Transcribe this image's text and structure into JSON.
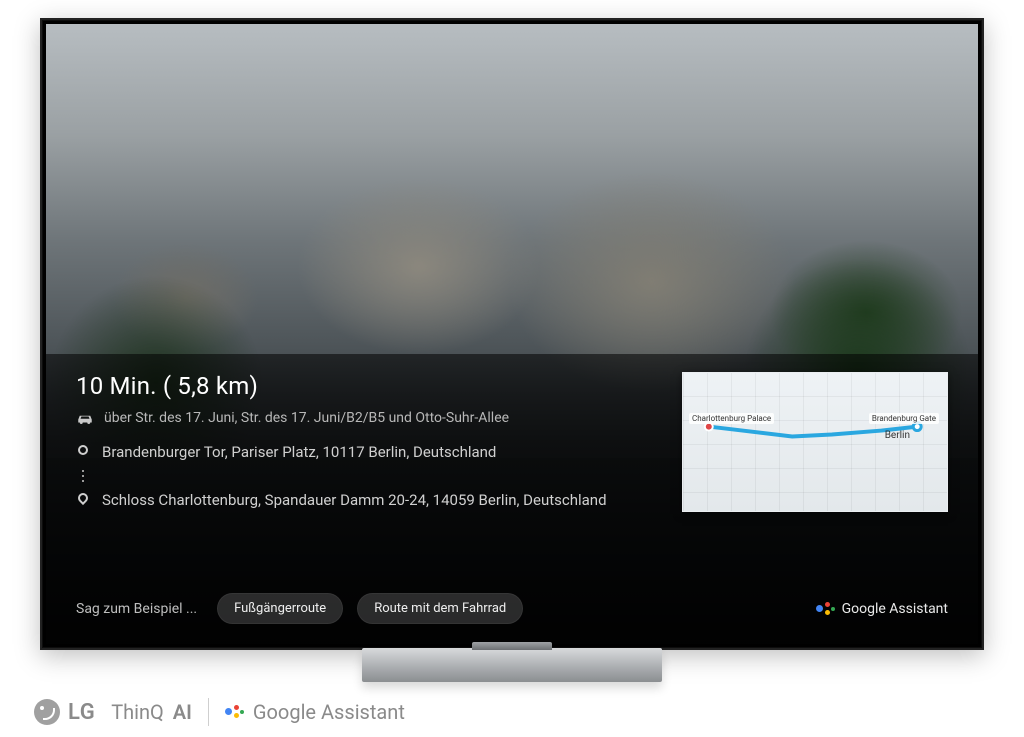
{
  "route": {
    "duration_distance": "10 Min. ( 5,8 km)",
    "via": "über Str. des 17. Juni, Str. des 17. Juni/B2/B5 und Otto-Suhr-Allee",
    "origin": "Brandenburger Tor, Pariser Platz, 10117 Berlin, Deutschland",
    "destination": "Schloss Charlottenburg, Spandauer Damm 20-24, 14059 Berlin, Deutschland"
  },
  "map": {
    "label_origin": "Brandenburg Gate",
    "label_destination": "Charlottenburg Palace",
    "city_label": "Berlin"
  },
  "suggestions": {
    "prompt": "Sag zum Beispiel ...",
    "chips": [
      "Fußgängerroute",
      "Route mit dem Fahrrad"
    ]
  },
  "brand": {
    "assistant": "Google Assistant",
    "footer_lg": "LG",
    "footer_thinq": "ThinQ",
    "footer_ai": "AI",
    "footer_assistant": "Google Assistant"
  },
  "colors": {
    "route_stroke": "#2aa7e0"
  }
}
